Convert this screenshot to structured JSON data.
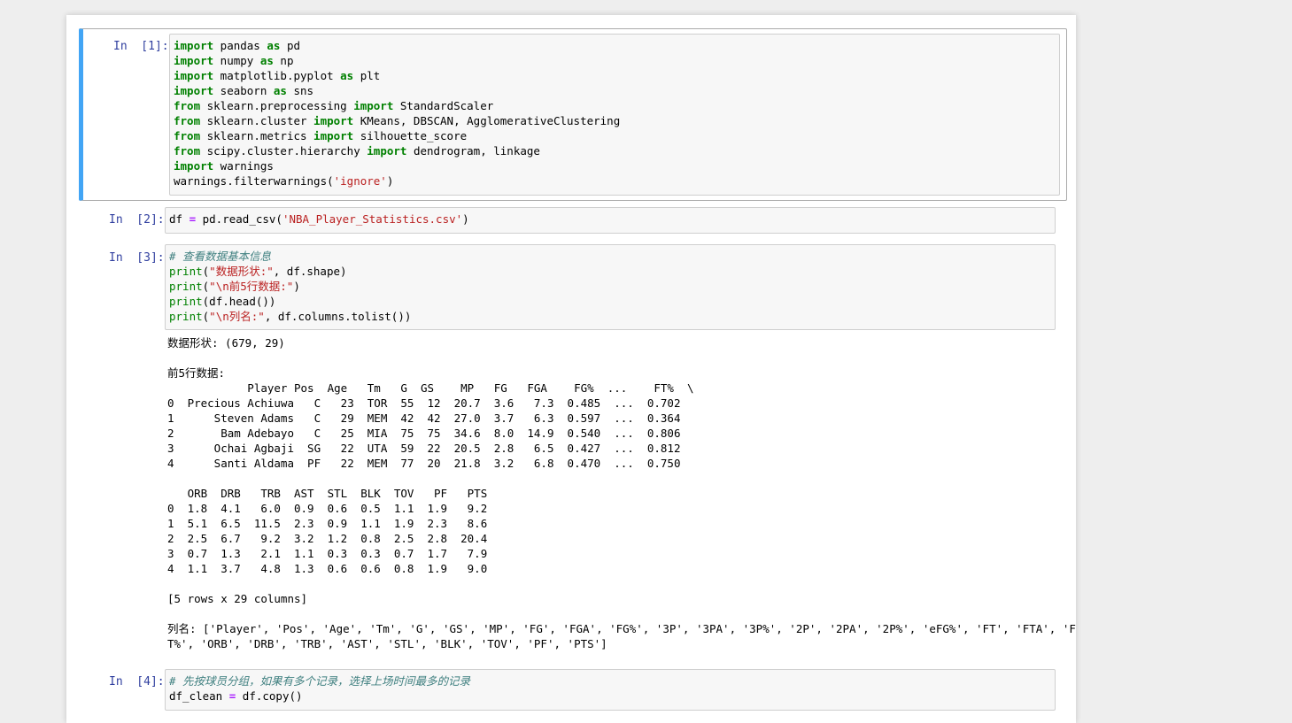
{
  "cells": [
    {
      "prompt": "In  [1]:",
      "lines": [
        [
          [
            "kw",
            "import"
          ],
          [
            "t",
            " pandas "
          ],
          [
            "kw",
            "as"
          ],
          [
            "t",
            " pd"
          ]
        ],
        [
          [
            "kw",
            "import"
          ],
          [
            "t",
            " numpy "
          ],
          [
            "kw",
            "as"
          ],
          [
            "t",
            " np"
          ]
        ],
        [
          [
            "kw",
            "import"
          ],
          [
            "t",
            " matplotlib.pyplot "
          ],
          [
            "kw",
            "as"
          ],
          [
            "t",
            " plt"
          ]
        ],
        [
          [
            "kw",
            "import"
          ],
          [
            "t",
            " seaborn "
          ],
          [
            "kw",
            "as"
          ],
          [
            "t",
            " sns"
          ]
        ],
        [
          [
            "kw",
            "from"
          ],
          [
            "t",
            " sklearn.preprocessing "
          ],
          [
            "kw",
            "import"
          ],
          [
            "t",
            " StandardScaler"
          ]
        ],
        [
          [
            "kw",
            "from"
          ],
          [
            "t",
            " sklearn.cluster "
          ],
          [
            "kw",
            "import"
          ],
          [
            "t",
            " KMeans, DBSCAN, AgglomerativeClustering"
          ]
        ],
        [
          [
            "kw",
            "from"
          ],
          [
            "t",
            " sklearn.metrics "
          ],
          [
            "kw",
            "import"
          ],
          [
            "t",
            " silhouette_score"
          ]
        ],
        [
          [
            "kw",
            "from"
          ],
          [
            "t",
            " scipy.cluster.hierarchy "
          ],
          [
            "kw",
            "import"
          ],
          [
            "t",
            " dendrogram, linkage"
          ]
        ],
        [
          [
            "kw",
            "import"
          ],
          [
            "t",
            " warnings"
          ]
        ],
        [
          [
            "t",
            "warnings.filterwarnings("
          ],
          [
            "str",
            "'ignore'"
          ],
          [
            "t",
            ")"
          ]
        ]
      ]
    },
    {
      "prompt": "In  [2]:",
      "lines": [
        [
          [
            "t",
            "df "
          ],
          [
            "op",
            "="
          ],
          [
            "t",
            " pd.read_csv("
          ],
          [
            "str",
            "'NBA_Player_Statistics.csv'"
          ],
          [
            "t",
            ")"
          ]
        ]
      ]
    },
    {
      "prompt": "In  [3]:",
      "lines": [
        [
          [
            "cm",
            "# 查看数据基本信息"
          ]
        ],
        [
          [
            "bi",
            "print"
          ],
          [
            "t",
            "("
          ],
          [
            "str",
            "\"数据形状:\""
          ],
          [
            "t",
            ", df.shape)"
          ]
        ],
        [
          [
            "bi",
            "print"
          ],
          [
            "t",
            "("
          ],
          [
            "str",
            "\"\\n前5行数据:\""
          ],
          [
            "t",
            ")"
          ]
        ],
        [
          [
            "bi",
            "print"
          ],
          [
            "t",
            "(df.head())"
          ]
        ],
        [
          [
            "bi",
            "print"
          ],
          [
            "t",
            "("
          ],
          [
            "str",
            "\"\\n列名:\""
          ],
          [
            "t",
            ", df.columns.tolist())"
          ]
        ]
      ],
      "output": "数据形状: (679, 29)\n\n前5行数据:\n            Player Pos  Age   Tm   G  GS    MP   FG   FGA    FG%  ...    FT%  \\\n0  Precious Achiuwa   C   23  TOR  55  12  20.7  3.6   7.3  0.485  ...  0.702   \n1      Steven Adams   C   29  MEM  42  42  27.0  3.7   6.3  0.597  ...  0.364   \n2       Bam Adebayo   C   25  MIA  75  75  34.6  8.0  14.9  0.540  ...  0.806   \n3      Ochai Agbaji  SG   22  UTA  59  22  20.5  2.8   6.5  0.427  ...  0.812   \n4      Santi Aldama  PF   22  MEM  77  20  21.8  3.2   6.8  0.470  ...  0.750   \n\n   ORB  DRB   TRB  AST  STL  BLK  TOV   PF   PTS  \n0  1.8  4.1   6.0  0.9  0.6  0.5  1.1  1.9   9.2  \n1  5.1  6.5  11.5  2.3  0.9  1.1  1.9  2.3   8.6  \n2  2.5  6.7   9.2  3.2  1.2  0.8  2.5  2.8  20.4  \n3  0.7  1.3   2.1  1.1  0.3  0.3  0.7  1.7   7.9  \n4  1.1  3.7   4.8  1.3  0.6  0.6  0.8  1.9   9.0  \n\n[5 rows x 29 columns]\n\n列名: ['Player', 'Pos', 'Age', 'Tm', 'G', 'GS', 'MP', 'FG', 'FGA', 'FG%', '3P', '3PA', '3P%', '2P', '2PA', '2P%', 'eFG%', 'FT', 'FTA', 'F\nT%', 'ORB', 'DRB', 'TRB', 'AST', 'STL', 'BLK', 'TOV', 'PF', 'PTS']"
    },
    {
      "prompt": "In  [4]:",
      "lines": [
        [
          [
            "cm",
            "# 先按球员分组，如果有多个记录，选择上场时间最多的记录"
          ]
        ],
        [
          [
            "t",
            "df_clean "
          ],
          [
            "op",
            "="
          ],
          [
            "t",
            " df.copy()"
          ]
        ]
      ]
    }
  ]
}
